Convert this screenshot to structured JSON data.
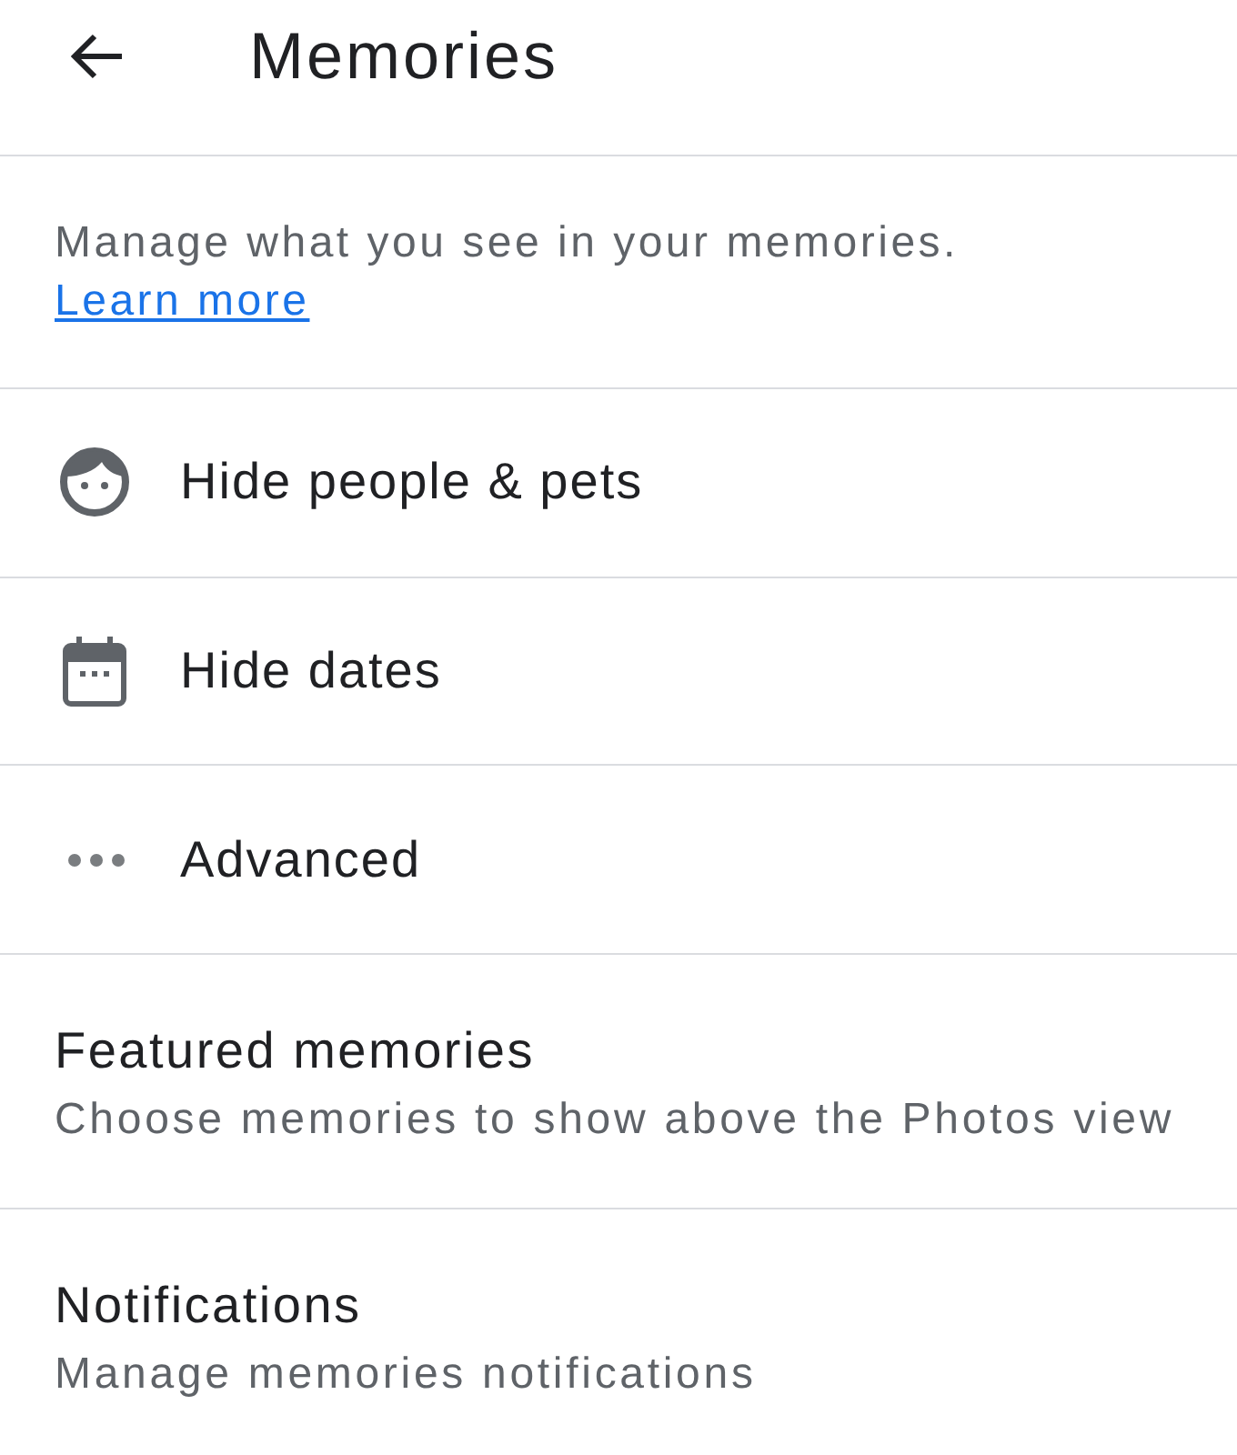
{
  "header": {
    "title": "Memories"
  },
  "intro": {
    "text": "Manage what you see in your memories.",
    "link": "Learn more"
  },
  "options": [
    {
      "kind": "face",
      "label": "Hide people & pets"
    },
    {
      "kind": "calendar",
      "label": "Hide dates"
    },
    {
      "kind": "dots",
      "label": "Advanced"
    }
  ],
  "settings": [
    {
      "title": "Featured memories",
      "subtitle": "Choose memories to show above the Photos view"
    },
    {
      "title": "Notifications",
      "subtitle": "Manage memories notifications"
    }
  ]
}
